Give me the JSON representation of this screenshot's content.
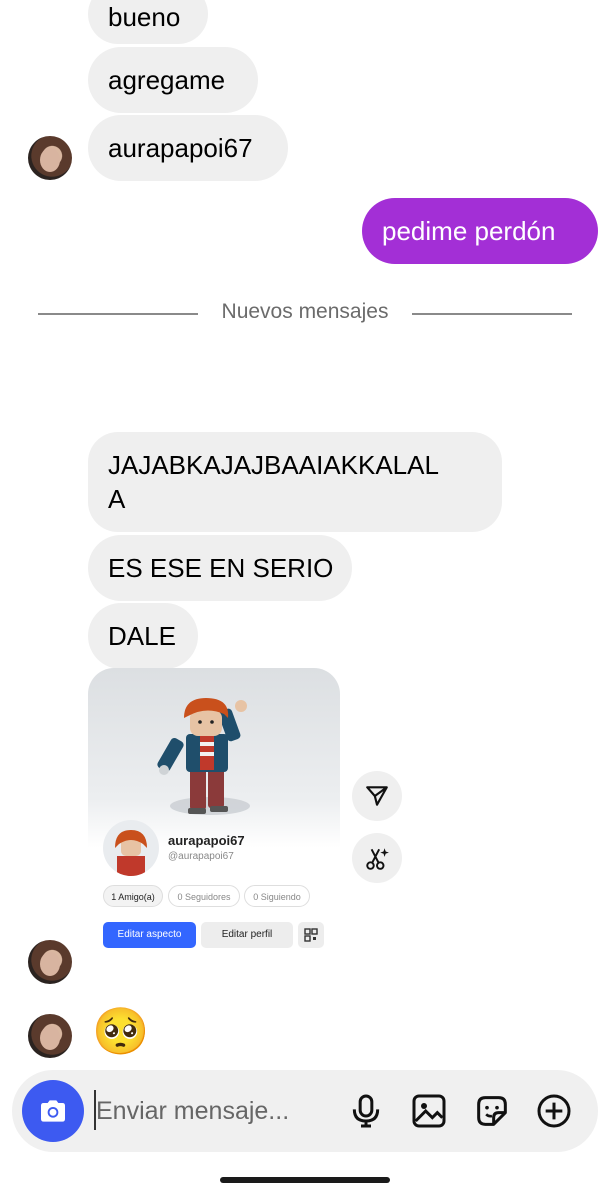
{
  "messages": {
    "top_received": [
      "bueno",
      "agregame",
      "aurapapoi67"
    ],
    "sent": "pedime perdón",
    "divider": "Nuevos mensajes",
    "new_received": [
      "JAJABKAJAJBAAIAKKALAL\nA",
      "ES ESE EN SERIO",
      "DALE"
    ],
    "emoji_reaction": "🥺"
  },
  "profile_card": {
    "display_name": "aurapapoi67",
    "handle": "@aurapapoi67",
    "stats": [
      "1 Amigo(a)",
      "0 Seguidores",
      "0 Siguiendo"
    ],
    "edit_avatar_label": "Editar aspecto",
    "edit_profile_label": "Editar perfil"
  },
  "composer": {
    "placeholder": "Enviar mensaje..."
  },
  "colors": {
    "sent_bubble": "#a32fd6",
    "received_bubble": "#efefef",
    "camera_button": "#3d5af1",
    "edit_avatar_button": "#3366ff"
  },
  "icons": [
    "camera-icon",
    "microphone-icon",
    "image-icon",
    "sticker-icon",
    "plus-circle-icon",
    "share-icon",
    "magic-scissors-icon",
    "qr-code-icon"
  ]
}
